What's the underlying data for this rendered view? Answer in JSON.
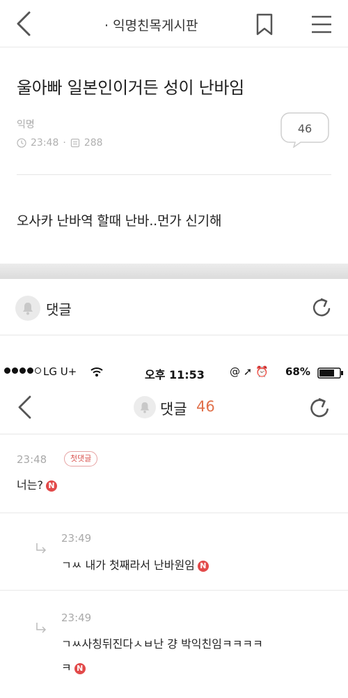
{
  "top": {
    "board_title": "· 익명친목게시판",
    "post_title": "울아빠 일본인이거든 성이 난바임",
    "author": "익명",
    "time": "23:48",
    "views": "288",
    "comment_count": "46",
    "body": "오사카 난바역 할때 난바..먼가 신기해",
    "comment_label": "댓글"
  },
  "status_bar": {
    "carrier": "LG U+",
    "time": "오후 11:53",
    "icons": "@ ➚ ⏰",
    "battery": "68%"
  },
  "comments_header": {
    "label": "댓글",
    "count": "46"
  },
  "comments": [
    {
      "time": "23:48",
      "badge": "첫댓글",
      "text": "너는?"
    },
    {
      "time": "23:49",
      "text": "ㄱㅆ 내가 첫째라서 난바원임"
    },
    {
      "time": "23:49",
      "text_line1": "ㄱㅆ사칭뒤진다ㅅㅂ난 걍 박익친임ㅋㅋㅋㅋ",
      "text_line2": "ㅋ"
    }
  ],
  "n_badge": "N",
  "colors": {
    "accent_count": "#e0704a",
    "new_badge": "#e24a4a"
  }
}
